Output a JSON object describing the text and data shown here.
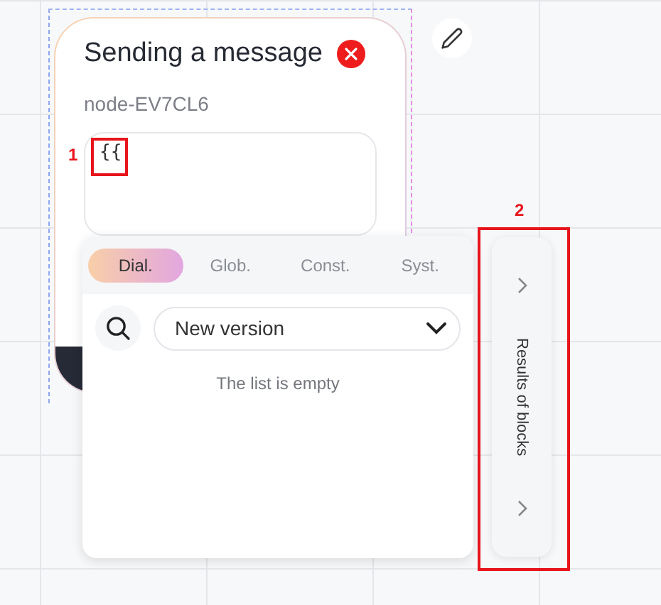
{
  "node": {
    "title": "Sending a message",
    "node_id": "node-EV7CL6",
    "input_value": "{{"
  },
  "variables_popup": {
    "tabs": [
      {
        "label": "Dial.",
        "selected": true
      },
      {
        "label": "Glob.",
        "selected": false
      },
      {
        "label": "Const.",
        "selected": false
      },
      {
        "label": "Syst.",
        "selected": false
      }
    ],
    "select": {
      "value": "New version"
    },
    "empty_text": "The list is empty"
  },
  "results_panel": {
    "label": "Results of blocks"
  },
  "annotations": [
    {
      "number": "1"
    },
    {
      "number": "2"
    }
  ]
}
